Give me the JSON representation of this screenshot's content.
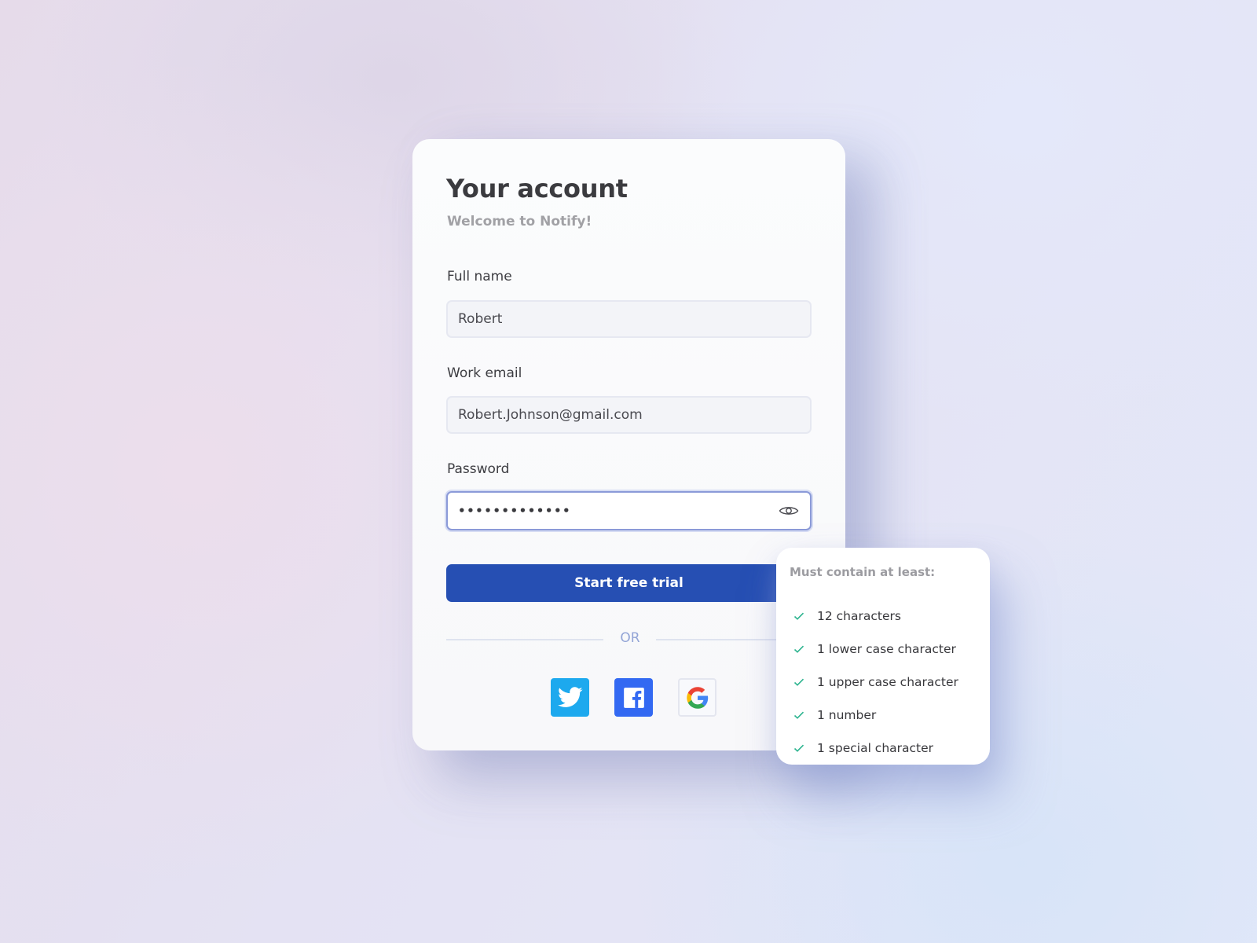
{
  "card": {
    "title": "Your account",
    "subtitle": "Welcome to Notify!",
    "fields": {
      "full_name": {
        "label": "Full name",
        "value": "Robert"
      },
      "work_email": {
        "label": "Work email",
        "value": "Robert.Johnson@gmail.com"
      },
      "password": {
        "label": "Password",
        "masked_value": "•••••••••••••",
        "icon": "eye-icon"
      }
    },
    "cta_label": "Start free trial",
    "divider_text": "OR",
    "social_buttons": [
      {
        "name": "twitter",
        "icon": "twitter-icon",
        "color": "#1da9ee"
      },
      {
        "name": "facebook",
        "icon": "facebook-icon",
        "color": "#3369f2"
      },
      {
        "name": "google",
        "icon": "google-icon",
        "color": "#f8f9fc"
      }
    ]
  },
  "password_requirements": {
    "title": "Must contain at least:",
    "items": [
      {
        "label": "12 characters",
        "met": true
      },
      {
        "label": "1 lower case character",
        "met": true
      },
      {
        "label": "1 upper case character",
        "met": true
      },
      {
        "label": "1 number",
        "met": true
      },
      {
        "label": "1 special character",
        "met": true
      }
    ],
    "check_color": "#2bb38e"
  },
  "colors": {
    "primary": "#264fb3",
    "focus_border": "#8b9ad8",
    "title_text": "#3b3b3f",
    "muted_text": "#a1a1a5"
  }
}
